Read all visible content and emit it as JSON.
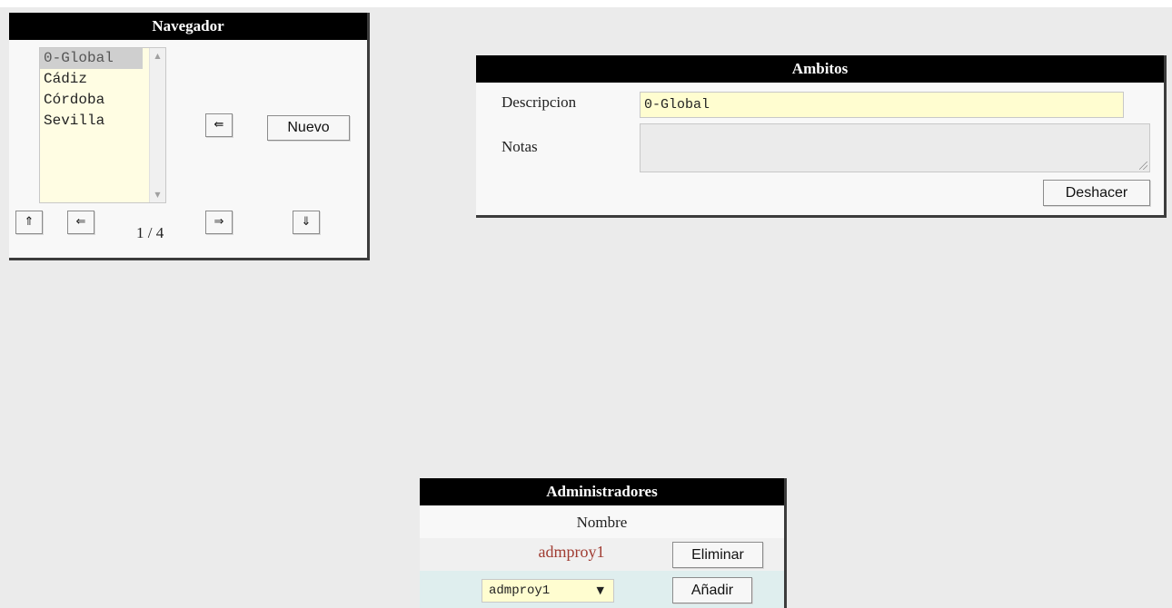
{
  "navegador": {
    "title": "Navegador",
    "list_items": [
      "0-Global",
      "Cádiz",
      "Córdoba",
      "Sevilla"
    ],
    "selected_item": "0-Global",
    "button_back": "⇚",
    "button_new": "Nuevo",
    "button_first": "⇑",
    "button_prev": "⇐",
    "page_counter": "1 / 4",
    "button_next": "⇒",
    "button_last": "⇓"
  },
  "ambitos": {
    "title": "Ambitos",
    "descripcion_label": "Descripcion",
    "descripcion_value": "0-Global",
    "notas_label": "Notas",
    "notas_value": "",
    "undo_button": "Deshacer"
  },
  "administradores": {
    "title": "Administradores",
    "column_header": "Nombre",
    "admins": [
      {
        "name": "admproy1",
        "action": "Eliminar"
      }
    ],
    "add_select_value": "admproy1",
    "add_button": "Añadir"
  },
  "colors": {
    "background": "#ebebeb",
    "panel_header": "#000000",
    "input_background": "#fffdd0",
    "admin_name": "#a03c32"
  }
}
